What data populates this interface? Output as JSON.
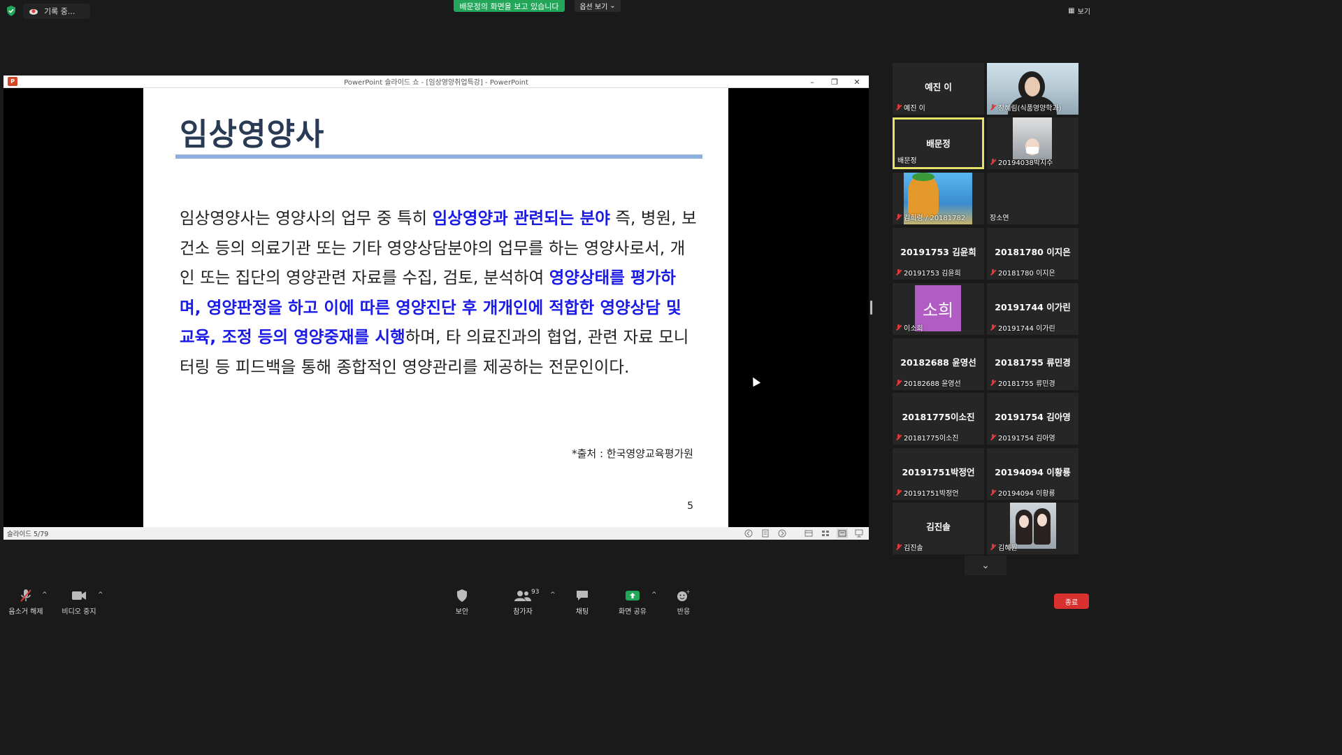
{
  "top": {
    "recording_label": "기록 중...",
    "viewing_banner": "배문정의 화면을 보고 있습니다",
    "view_options": "옵션 보기",
    "view_button": "보기"
  },
  "ppt": {
    "window_title": "PowerPoint 슬라이드 쇼 - [임상영양취업특강] - PowerPoint",
    "status_slide": "슬라이드 5/79",
    "slide": {
      "title": "임상영양사",
      "body": [
        {
          "t": "  임상영양사는 영양사의 업무 중 특히 ",
          "hl": false
        },
        {
          "t": "임상영양과 관련되는 분야",
          "hl": true
        },
        {
          "t": " 즉, 병원, 보건소 등의 의료기관 또는 기타 영양상담분야의 업무를 하는 영양사로서, 개인 또는 집단의 영양관련 자료를 수집, 검토, 분석하여 ",
          "hl": false
        },
        {
          "t": "영양상태를 평가하며, 영양판정을 하고 이에 따른 영양진단 후 개개인에 적합한 영양상담 및 교육, 조정 등의 영양중재를 시행",
          "hl": true
        },
        {
          "t": "하며, 타 의료진과의 협업, 관련 자료 모니터링 등 피드백을 통해 종합적인 영양관리를 제공하는 전문인이다.",
          "hl": false
        }
      ],
      "source": "*출처 : 한국영양교육평가원",
      "page_number": "5"
    }
  },
  "participants": [
    {
      "center": "예진 이",
      "label": "예진 이",
      "kind": "name"
    },
    {
      "center": "",
      "label": "장혜림(식품영양학과)",
      "kind": "teacher"
    },
    {
      "center": "배문정",
      "label": "배문정",
      "kind": "name",
      "active": true,
      "no_mic": true
    },
    {
      "center": "",
      "label": "20194038박지수",
      "kind": "small"
    },
    {
      "center": "",
      "label": "김희령 / 20181782",
      "kind": "cartoon"
    },
    {
      "center": "",
      "label": "장소연",
      "kind": "blank",
      "no_mic": true
    },
    {
      "center": "20191753 김윤희",
      "label": "20191753 김윤희",
      "kind": "name"
    },
    {
      "center": "20181780 이지은",
      "label": "20181780 이지은",
      "kind": "name"
    },
    {
      "center": "소희",
      "label": "이소희",
      "kind": "avatar"
    },
    {
      "center": "20191744 이가린",
      "label": "20191744 이가린",
      "kind": "name"
    },
    {
      "center": "20182688 윤영선",
      "label": "20182688 윤영선",
      "kind": "name"
    },
    {
      "center": "20181755 류민경",
      "label": "20181755 류민경",
      "kind": "name"
    },
    {
      "center": "20181775이소진",
      "label": "20181775이소진",
      "kind": "name"
    },
    {
      "center": "20191754 김아영",
      "label": "20191754 김아영",
      "kind": "name"
    },
    {
      "center": "20191751박정언",
      "label": "20191751박정언",
      "kind": "name"
    },
    {
      "center": "20194094 이황룡",
      "label": "20194094 이황룡",
      "kind": "name"
    },
    {
      "center": "김진솔",
      "label": "김진솔",
      "kind": "name"
    },
    {
      "center": "",
      "label": "김혜원",
      "kind": "girls"
    }
  ],
  "toolbar": {
    "unmute": "음소거 해제",
    "stop_video": "비디오 중지",
    "security": "보안",
    "participants": "참가자",
    "participants_count": "93",
    "chat": "채팅",
    "share_screen": "화면 공유",
    "reactions": "반응",
    "end": "종료"
  },
  "colors": {
    "banner_green": "#23a55a",
    "active_speaker": "#e4e26b",
    "slide_title": "#293a55",
    "highlight_text": "#1a1ae6",
    "end_red": "#d93030"
  }
}
